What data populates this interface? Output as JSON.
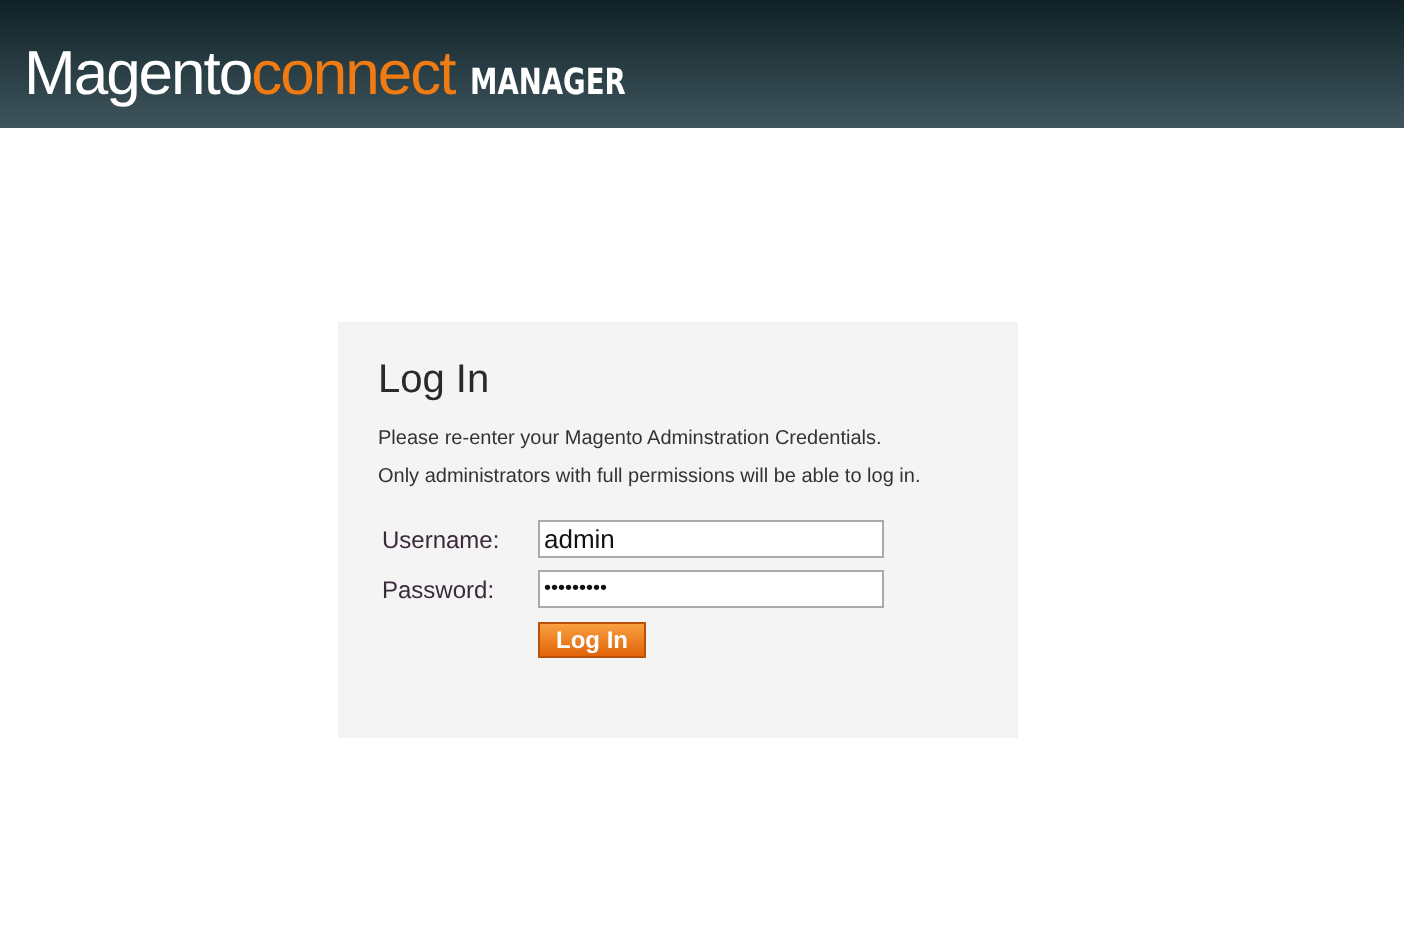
{
  "header": {
    "logo_brand": "Magento",
    "logo_product": "connect",
    "logo_suffix": "MANAGER"
  },
  "login": {
    "title": "Log In",
    "messages": [
      "Please re-enter your Magento Adminstration Credentials.",
      "Only administrators with full permissions will be able to log in."
    ],
    "fields": [
      {
        "label": "Username:",
        "value": "admin"
      },
      {
        "label": "Password:",
        "value": "•••••••••"
      }
    ],
    "button": "Log In"
  }
}
